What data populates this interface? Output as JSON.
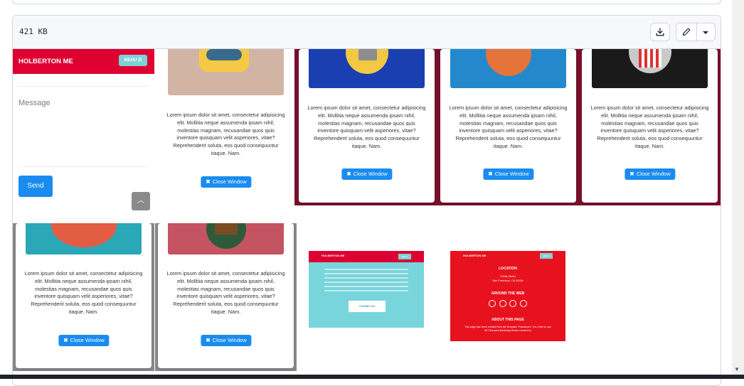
{
  "file": {
    "size": "421 KB"
  },
  "icons": {
    "download": "download-icon",
    "edit": "pencil-icon",
    "dropdown": "chevron-down-icon"
  },
  "colors": {
    "brand_red": "#dd0031",
    "button_blue": "#1a8cf0",
    "teal": "#7bd3d8"
  },
  "tiles": {
    "message_form": {
      "brand": "HOLBERTON ME",
      "menu": "MENU ☰",
      "placeholder": "Message",
      "send": "Send"
    },
    "card_text": "Lorem ipsum dolor sit amet, consectetur adipisicing elit. Mollitia neque assumenda ipsam nihil, molestias magnam, recusandae quos quis inventore quisquam velit asperiores, vitae? Reprehenderit soluta, eos quod consequuntur itaque. Nam.",
    "close_label": "Close Window",
    "contact_thumb": {
      "brand": "HOLBERTON ME",
      "menu": "MENU",
      "button": "Contact us"
    },
    "footer_thumb": {
      "brand": "HOLBERTON ME",
      "menu": "MENU",
      "location": "LOCATION",
      "address1": "3 Ellis Street",
      "address2": "San Francisco, CA 94108",
      "around": "AROUND THE WEB",
      "about": "ABOUT THIS PAGE",
      "about_text": "This page has been created from the template \"Freelancer\". It's a free to use MIT licensed Bootstrap theme created by"
    }
  }
}
